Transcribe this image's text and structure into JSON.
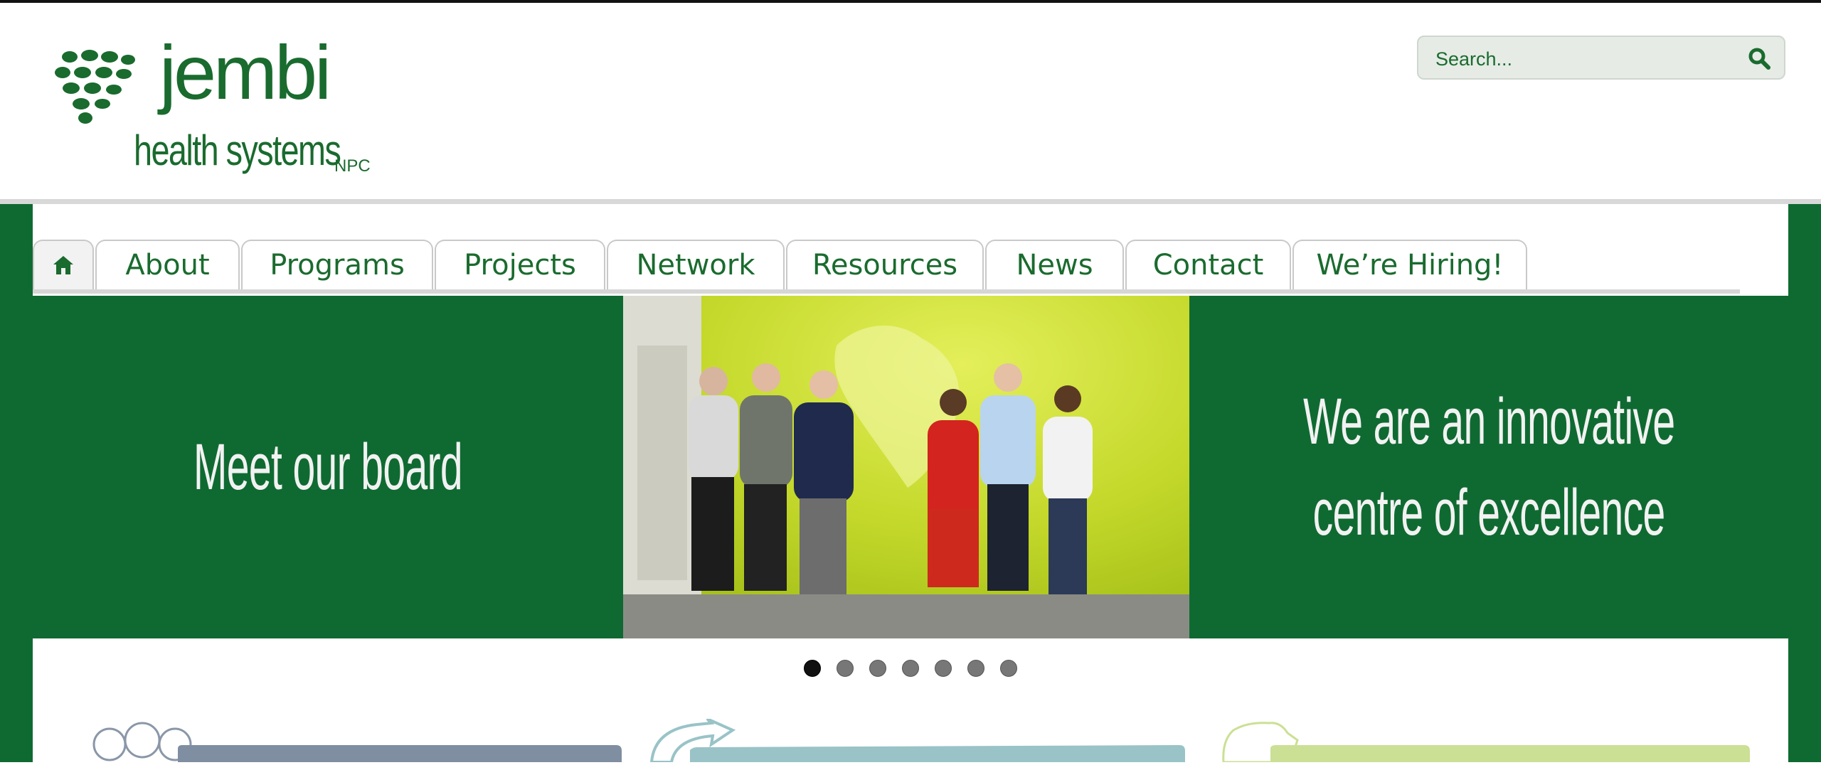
{
  "header": {
    "logo_word": "jembi",
    "logo_sub": "health systems",
    "logo_npc": "NPC",
    "search_placeholder": "Search..."
  },
  "nav": {
    "items": [
      {
        "label": "About"
      },
      {
        "label": "Programs"
      },
      {
        "label": "Projects"
      },
      {
        "label": "Network"
      },
      {
        "label": "Resources"
      },
      {
        "label": "News"
      },
      {
        "label": "Contact"
      },
      {
        "label": "We’re Hiring!"
      }
    ]
  },
  "slider": {
    "left_text": "Meet our board",
    "right_text_line1": "We are an innovative",
    "right_text_line2": "centre of excellence",
    "slide_count": 7,
    "active_slide": 1
  },
  "colors": {
    "brand_green": "#1a6b2e",
    "slide_green": "#0f6a31",
    "feature1": "#7f8ea1",
    "feature2": "#99c3c7",
    "feature3": "#cbe094"
  }
}
